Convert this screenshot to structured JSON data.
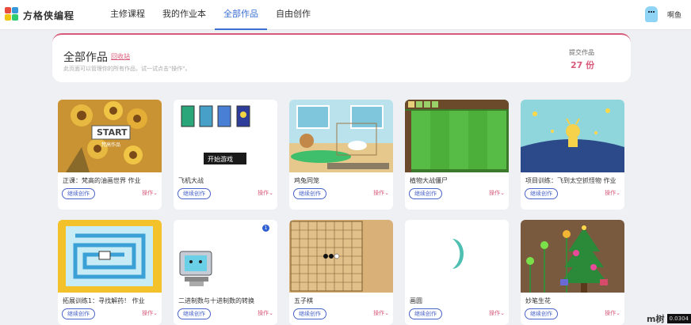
{
  "app": {
    "logo_text": "方格侠编程"
  },
  "nav": [
    {
      "label": "主修课程",
      "active": false
    },
    {
      "label": "我的作业本",
      "active": false
    },
    {
      "label": "全部作品",
      "active": true
    },
    {
      "label": "自由创作",
      "active": false
    }
  ],
  "user": {
    "name": "啊鱼"
  },
  "header": {
    "title": "全部作品",
    "recycle": "回收站",
    "subtitle": "此页面可以管理你的所有作品，试一试点击\"操作\"。",
    "submit_label": "提交作品",
    "submit_count": "27 份"
  },
  "cards": [
    {
      "title": "正课：梵高的油画世界 作业",
      "button": "继续创作",
      "ops": "操作"
    },
    {
      "title": "飞机大战",
      "button": "继续创作",
      "ops": "操作"
    },
    {
      "title": "鸡兔同笼",
      "button": "继续创作",
      "ops": "操作"
    },
    {
      "title": "植物大战僵尸",
      "button": "继续创作",
      "ops": "操作"
    },
    {
      "title": "项目训练：飞到太空抓怪物 作业",
      "button": "继续创作",
      "ops": "操作"
    },
    {
      "title": "拓展训练1：寻找解药！ 作业",
      "button": "继续创作",
      "ops": "操作"
    },
    {
      "title": "二进制数与十进制数的转换",
      "button": "继续创作",
      "ops": "操作"
    },
    {
      "title": "五子棋",
      "button": "继续创作",
      "ops": "操作"
    },
    {
      "title": "画圆",
      "button": "继续创作",
      "ops": "操作"
    },
    {
      "title": "妙笔生花",
      "button": "继续创作",
      "ops": "操作"
    }
  ],
  "thumbs": {
    "start_label": "START",
    "start_sub": "梵高作品",
    "game_start": "开始游戏",
    "badge": "1"
  },
  "watermark": {
    "logo": "m树",
    "code": "0.0304"
  },
  "colors": {
    "accent": "#3a6fd6",
    "pink": "#d95a7a",
    "button_blue": "#4a64c8"
  }
}
